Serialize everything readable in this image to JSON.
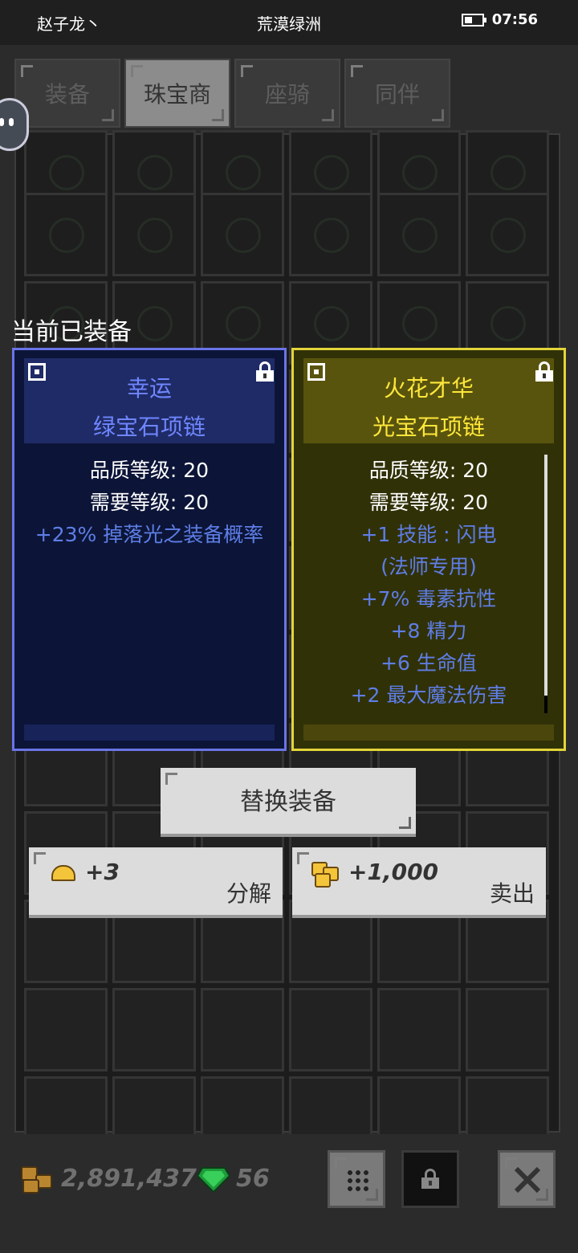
{
  "status_bar": {
    "left_text": "赵子龙丶",
    "center_text": "荒漠绿洲",
    "time": "07:56"
  },
  "tabs": [
    {
      "label": "装备",
      "active": false
    },
    {
      "label": "珠宝商",
      "active": true
    },
    {
      "label": "座骑",
      "active": false
    },
    {
      "label": "同伴",
      "active": false
    }
  ],
  "equipped_header": "当前已装备",
  "current_item": {
    "name_line1": "幸运",
    "name_line2": "绿宝石项链",
    "quality": "品质等级: 20",
    "required": "需要等级: 20",
    "bonuses": [
      "+23% 掉落光之装备概率"
    ],
    "color": "#6f86ff"
  },
  "new_item": {
    "name_line1": "火花才华",
    "name_line2": "光宝石项链",
    "quality": "品质等级: 20",
    "required": "需要等级: 20",
    "bonuses": [
      "+1 技能 : 闪电",
      "(法师专用)",
      "+7% 毒素抗性",
      "+8 精力",
      "+6 生命值",
      "+2 最大魔法伤害"
    ],
    "color": "#ffe73a"
  },
  "actions": {
    "replace_label": "替换装备",
    "salvage_value": "+3",
    "salvage_label": "分解",
    "sell_value": "+1,000",
    "sell_label": "卖出"
  },
  "footer": {
    "coins": "2,891,437",
    "gems": "56"
  },
  "icons": [
    "battery-icon",
    "chat-bubble-icon",
    "lock-icon",
    "gold-nugget-icon",
    "gold-coins-icon",
    "emerald-gem-icon",
    "grid-icon",
    "close-icon"
  ]
}
